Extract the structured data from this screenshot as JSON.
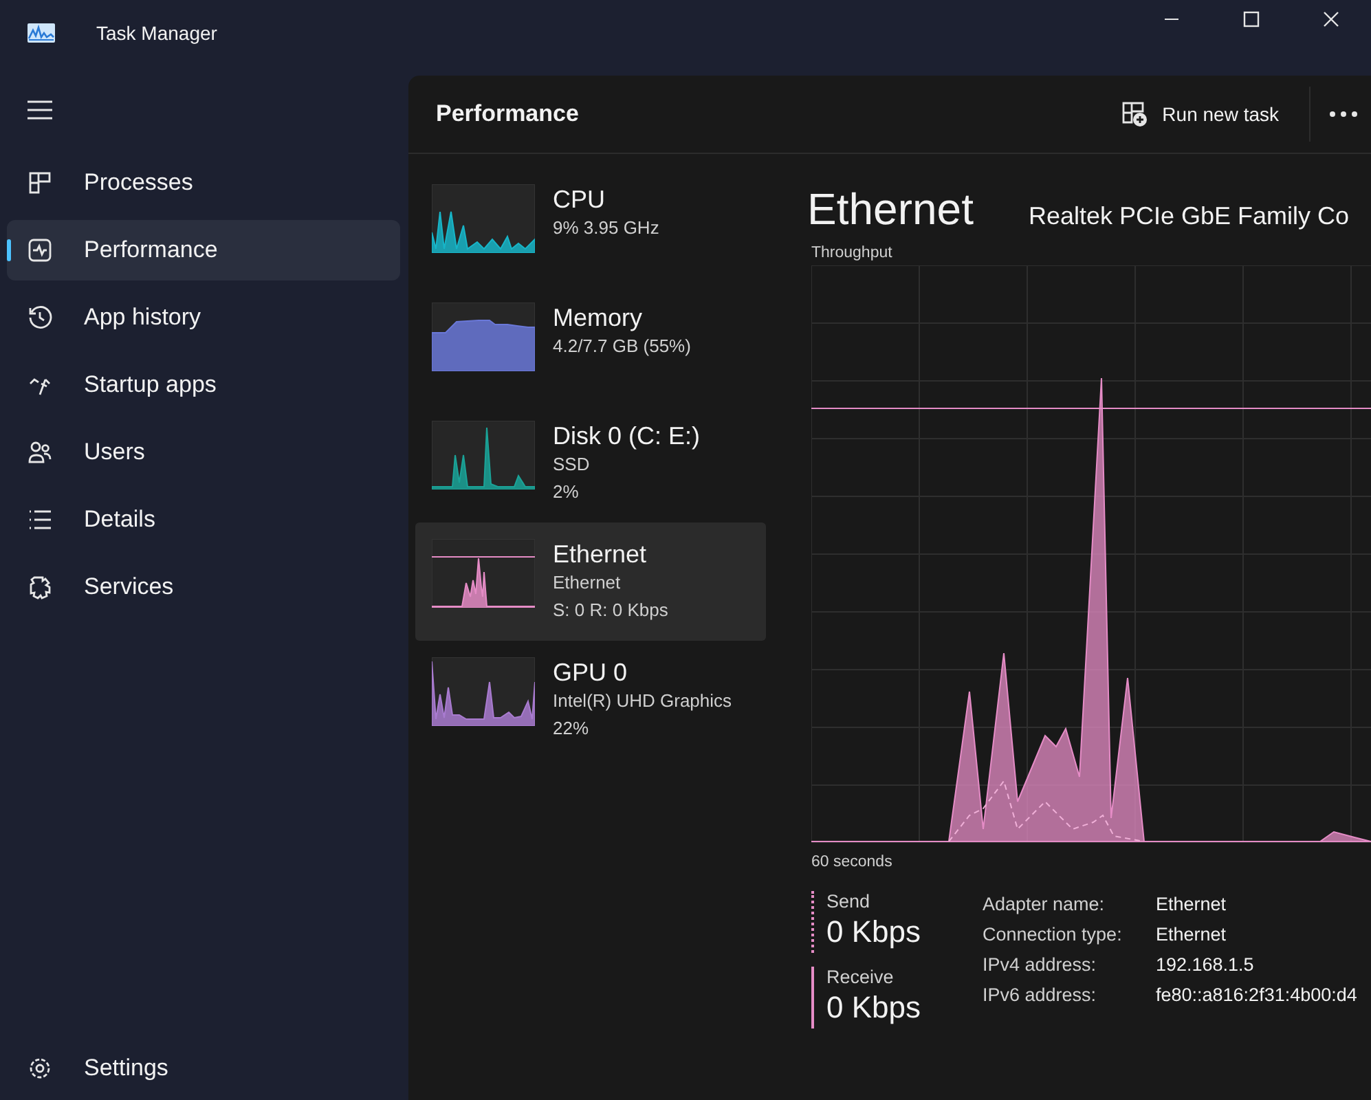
{
  "window": {
    "title": "Task Manager"
  },
  "sidebar": {
    "items": [
      {
        "label": "Processes",
        "selected": false
      },
      {
        "label": "Performance",
        "selected": true
      },
      {
        "label": "App history",
        "selected": false
      },
      {
        "label": "Startup apps",
        "selected": false
      },
      {
        "label": "Users",
        "selected": false
      },
      {
        "label": "Details",
        "selected": false
      },
      {
        "label": "Services",
        "selected": false
      }
    ],
    "footer": {
      "label": "Settings"
    }
  },
  "header": {
    "title": "Performance",
    "run_task": "Run new task"
  },
  "devices": [
    {
      "name": "CPU",
      "lines": [
        "9%  3.95 GHz"
      ],
      "color": "#17b5c8",
      "selected": false
    },
    {
      "name": "Memory",
      "lines": [
        "4.2/7.7 GB (55%)"
      ],
      "color": "#6a78d8",
      "selected": false
    },
    {
      "name": "Disk 0 (C: E:)",
      "lines": [
        "SSD",
        "2%"
      ],
      "color": "#1aa398",
      "selected": false
    },
    {
      "name": "Ethernet",
      "lines": [
        "Ethernet",
        "S: 0 R: 0 Kbps"
      ],
      "color": "#e58cc6",
      "selected": true
    },
    {
      "name": "GPU 0",
      "lines": [
        "Intel(R) UHD Graphics",
        "22%"
      ],
      "color": "#a97bd0",
      "selected": false
    }
  ],
  "detail": {
    "title": "Ethernet",
    "adapter": "Realtek PCIe GbE Family Co",
    "chart_label": "Throughput",
    "time_label": "60 seconds",
    "send": {
      "label": "Send",
      "value": "0 Kbps"
    },
    "receive": {
      "label": "Receive",
      "value": "0 Kbps"
    },
    "info": [
      {
        "label": "Adapter name:",
        "value": "Ethernet"
      },
      {
        "label": "Connection type:",
        "value": "Ethernet"
      },
      {
        "label": "IPv4 address:",
        "value": "192.168.1.5"
      },
      {
        "label": "IPv6 address:",
        "value": "fe80::a816:2f31:4b00:d4"
      }
    ]
  }
}
